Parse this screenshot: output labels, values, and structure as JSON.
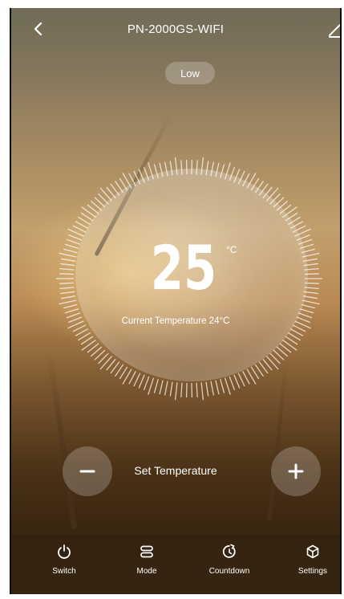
{
  "header": {
    "title": "PN-2000GS-WIFI",
    "back_icon": "chevron-left-icon",
    "edit_icon": "edit-icon"
  },
  "mode": {
    "label": "Low"
  },
  "dial": {
    "temperature": "25",
    "unit": "°C",
    "current_label": "Current Temperature 24°C"
  },
  "controls": {
    "minus_icon": "minus-icon",
    "plus_icon": "plus-icon",
    "set_label": "Set Temperature"
  },
  "tabs": [
    {
      "label": "Switch",
      "icon": "power-icon"
    },
    {
      "label": "Mode",
      "icon": "mode-icon"
    },
    {
      "label": "Countdown",
      "icon": "countdown-icon"
    },
    {
      "label": "Settings",
      "icon": "settings-icon"
    }
  ],
  "colors": {
    "text": "#ffffff",
    "background_top": "#6f6a57",
    "background_mid": "#c29f6d",
    "background_bottom": "#3e2a13"
  }
}
